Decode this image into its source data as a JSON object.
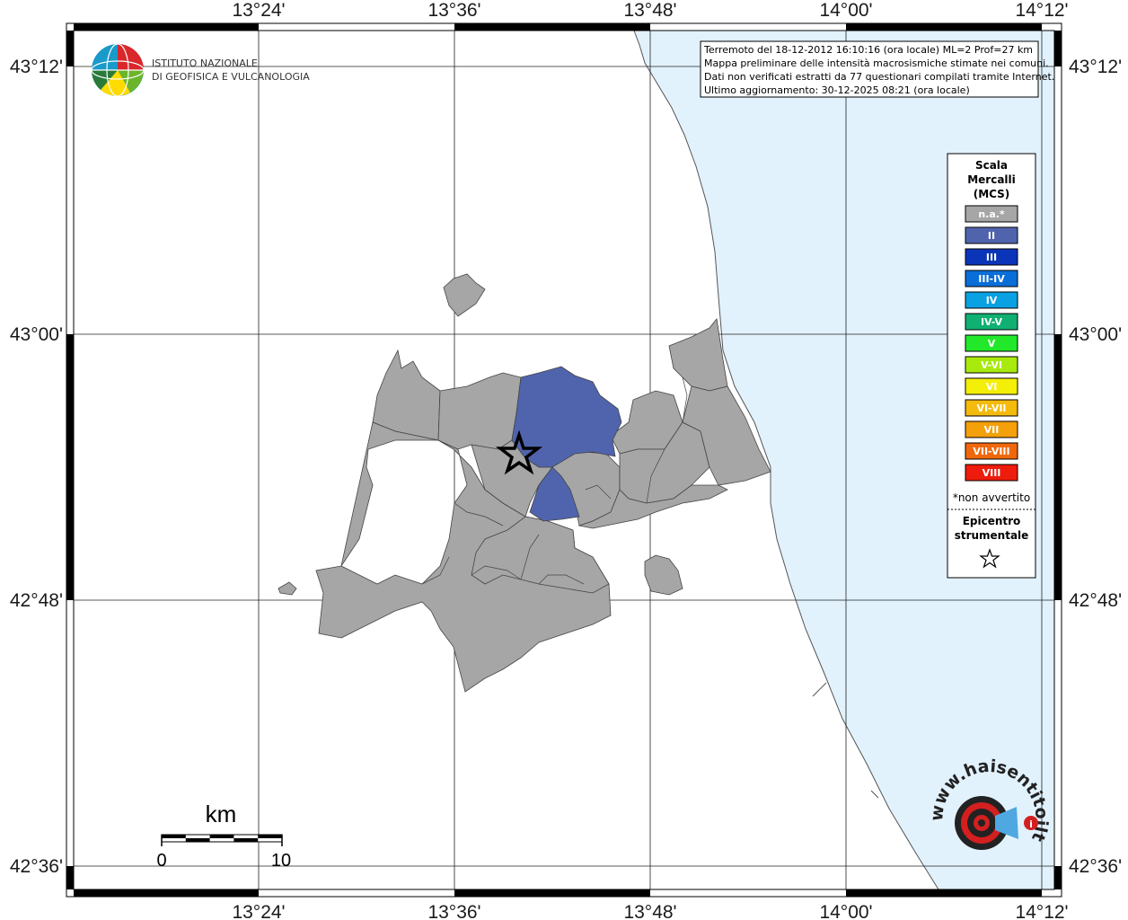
{
  "map_info": {
    "lines": [
      "Terremoto del 18-12-2012 16:10:16 (ora locale) ML=2 Prof=27 km",
      "Mappa preliminare delle intensità macrosismiche stimate nei comuni.",
      "Dati non verificati estratti da 77 questionari compilati tramite Internet.",
      "Ultimo aggiornamento: 30-12-2025 08:21 (ora locale)"
    ]
  },
  "logo": {
    "line1": "ISTITUTO NAZIONALE",
    "line2": "DI GEOFISICA E VULCANOLOGIA"
  },
  "axes": {
    "lon_labels": [
      "13°24'",
      "13°36'",
      "13°48'",
      "14°00'",
      "14°12'"
    ],
    "lat_labels": [
      "43°12'",
      "43°00'",
      "42°48'",
      "42°36'"
    ]
  },
  "legend": {
    "title": [
      "Scala",
      "Mercalli",
      "(MCS)"
    ],
    "items": [
      {
        "label": "n.a.*",
        "color": "#a6a6a6"
      },
      {
        "label": "II",
        "color": "#5064ad"
      },
      {
        "label": "III",
        "color": "#0b35b8"
      },
      {
        "label": "III-IV",
        "color": "#0a6ed8"
      },
      {
        "label": "IV",
        "color": "#0aa1e2"
      },
      {
        "label": "IV-V",
        "color": "#0fb072"
      },
      {
        "label": "V",
        "color": "#22e82a"
      },
      {
        "label": "V-VI",
        "color": "#a8ea0e"
      },
      {
        "label": "VI",
        "color": "#f4ef07"
      },
      {
        "label": "VI-VII",
        "color": "#f4ba0c"
      },
      {
        "label": "VII",
        "color": "#f4a00b"
      },
      {
        "label": "VII-VIII",
        "color": "#f0680c"
      },
      {
        "label": "VIII",
        "color": "#ee1c0c"
      }
    ],
    "footnote": "*non avvertito",
    "epicenter_title": [
      "Epicentro",
      "strumentale"
    ]
  },
  "scale_bar": {
    "unit": "km",
    "min": "0",
    "max": "10"
  },
  "watermark": {
    "text": "www.haisentitoilterremoto.it"
  },
  "colors": {
    "sea": "#e1f2fd",
    "felt_ii": "#5064ad",
    "not_felt": "#a6a6a6"
  }
}
